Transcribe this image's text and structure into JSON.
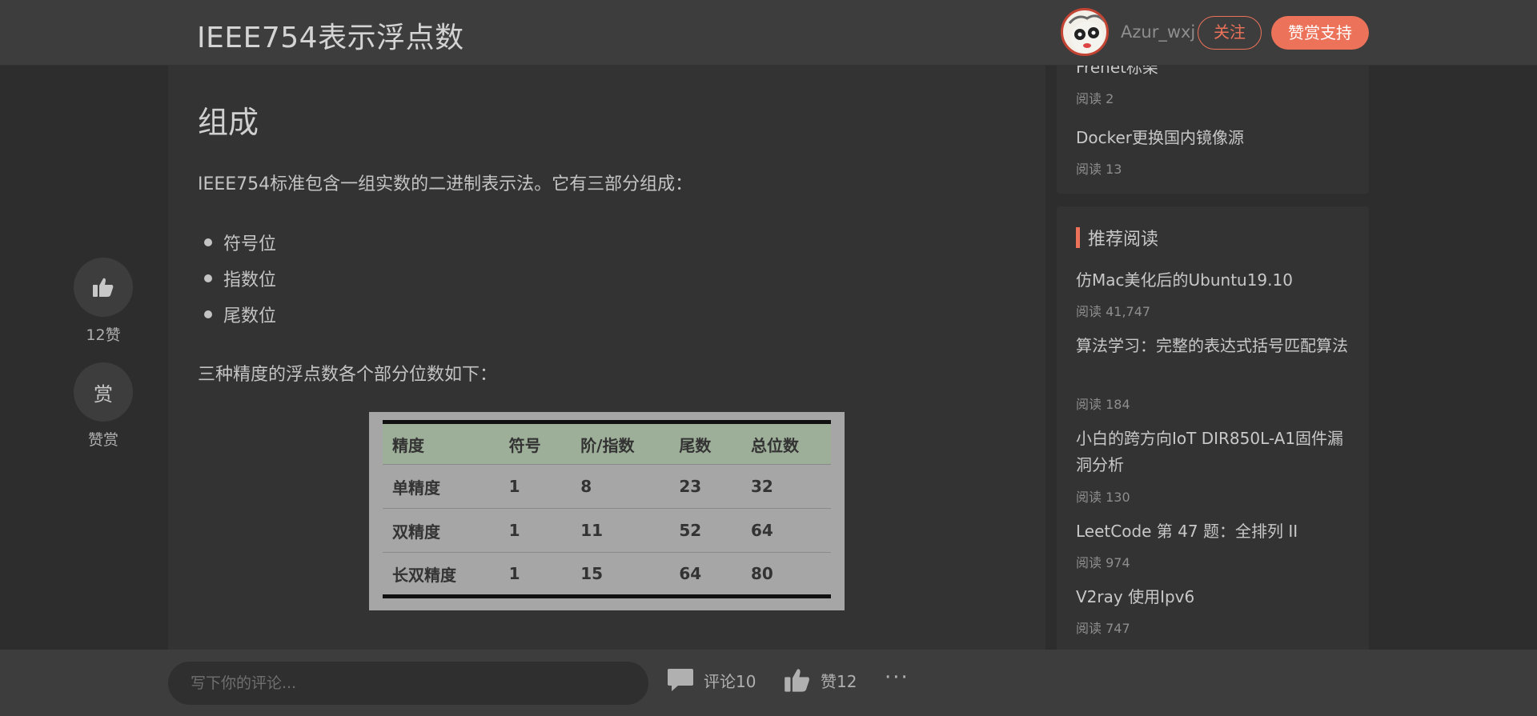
{
  "header": {
    "title": "IEEE754表示浮点数",
    "username": "Azur_wxj",
    "follow_label": "关注",
    "support_label": "赞赏支持"
  },
  "side_actions": {
    "like_label": "12赞",
    "reward_glyph": "赏",
    "reward_label": "赞赏"
  },
  "article": {
    "section_heading": "组成",
    "intro": "IEEE754标准包含一组实数的二进制表示法。它有三部分组成：",
    "bullets": [
      "符号位",
      "指数位",
      "尾数位"
    ],
    "precision_text": "三种精度的浮点数各个部分位数如下：",
    "table": {
      "headers": [
        "精度",
        "符号",
        "阶/指数",
        "尾数",
        "总位数"
      ],
      "rows": [
        [
          "单精度",
          "1",
          "8",
          "23",
          "32"
        ],
        [
          "双精度",
          "1",
          "11",
          "52",
          "64"
        ],
        [
          "长双精度",
          "1",
          "15",
          "64",
          "80"
        ]
      ]
    }
  },
  "sidebar": {
    "top_items": [
      {
        "title": "Frenet标架",
        "reads": "阅读 2"
      },
      {
        "title": "Docker更换国内镜像源",
        "reads": "阅读 13"
      }
    ],
    "recommend_heading": "推荐阅读",
    "recommend_items": [
      {
        "title": "仿Mac美化后的Ubuntu19.10",
        "reads": "阅读 41,747"
      },
      {
        "title": "算法学习：完整的表达式括号匹配算法",
        "reads": "阅读 184"
      },
      {
        "title": "小白的跨方向IoT DIR850L-A1固件漏洞分析",
        "reads": "阅读 130"
      },
      {
        "title": "LeetCode 第 47 题：全排列 II",
        "reads": "阅读 974"
      },
      {
        "title": "V2ray 使用Ipv6",
        "reads": "阅读 747"
      }
    ]
  },
  "bottom_bar": {
    "comment_placeholder": "写下你的评论...",
    "comment_label": "评论10",
    "like_label": "赞12",
    "more_label": "···"
  },
  "colors": {
    "accent": "#ec7259",
    "background": "#2d2d2d",
    "panel": "#333333",
    "header": "#3d3d3d"
  }
}
